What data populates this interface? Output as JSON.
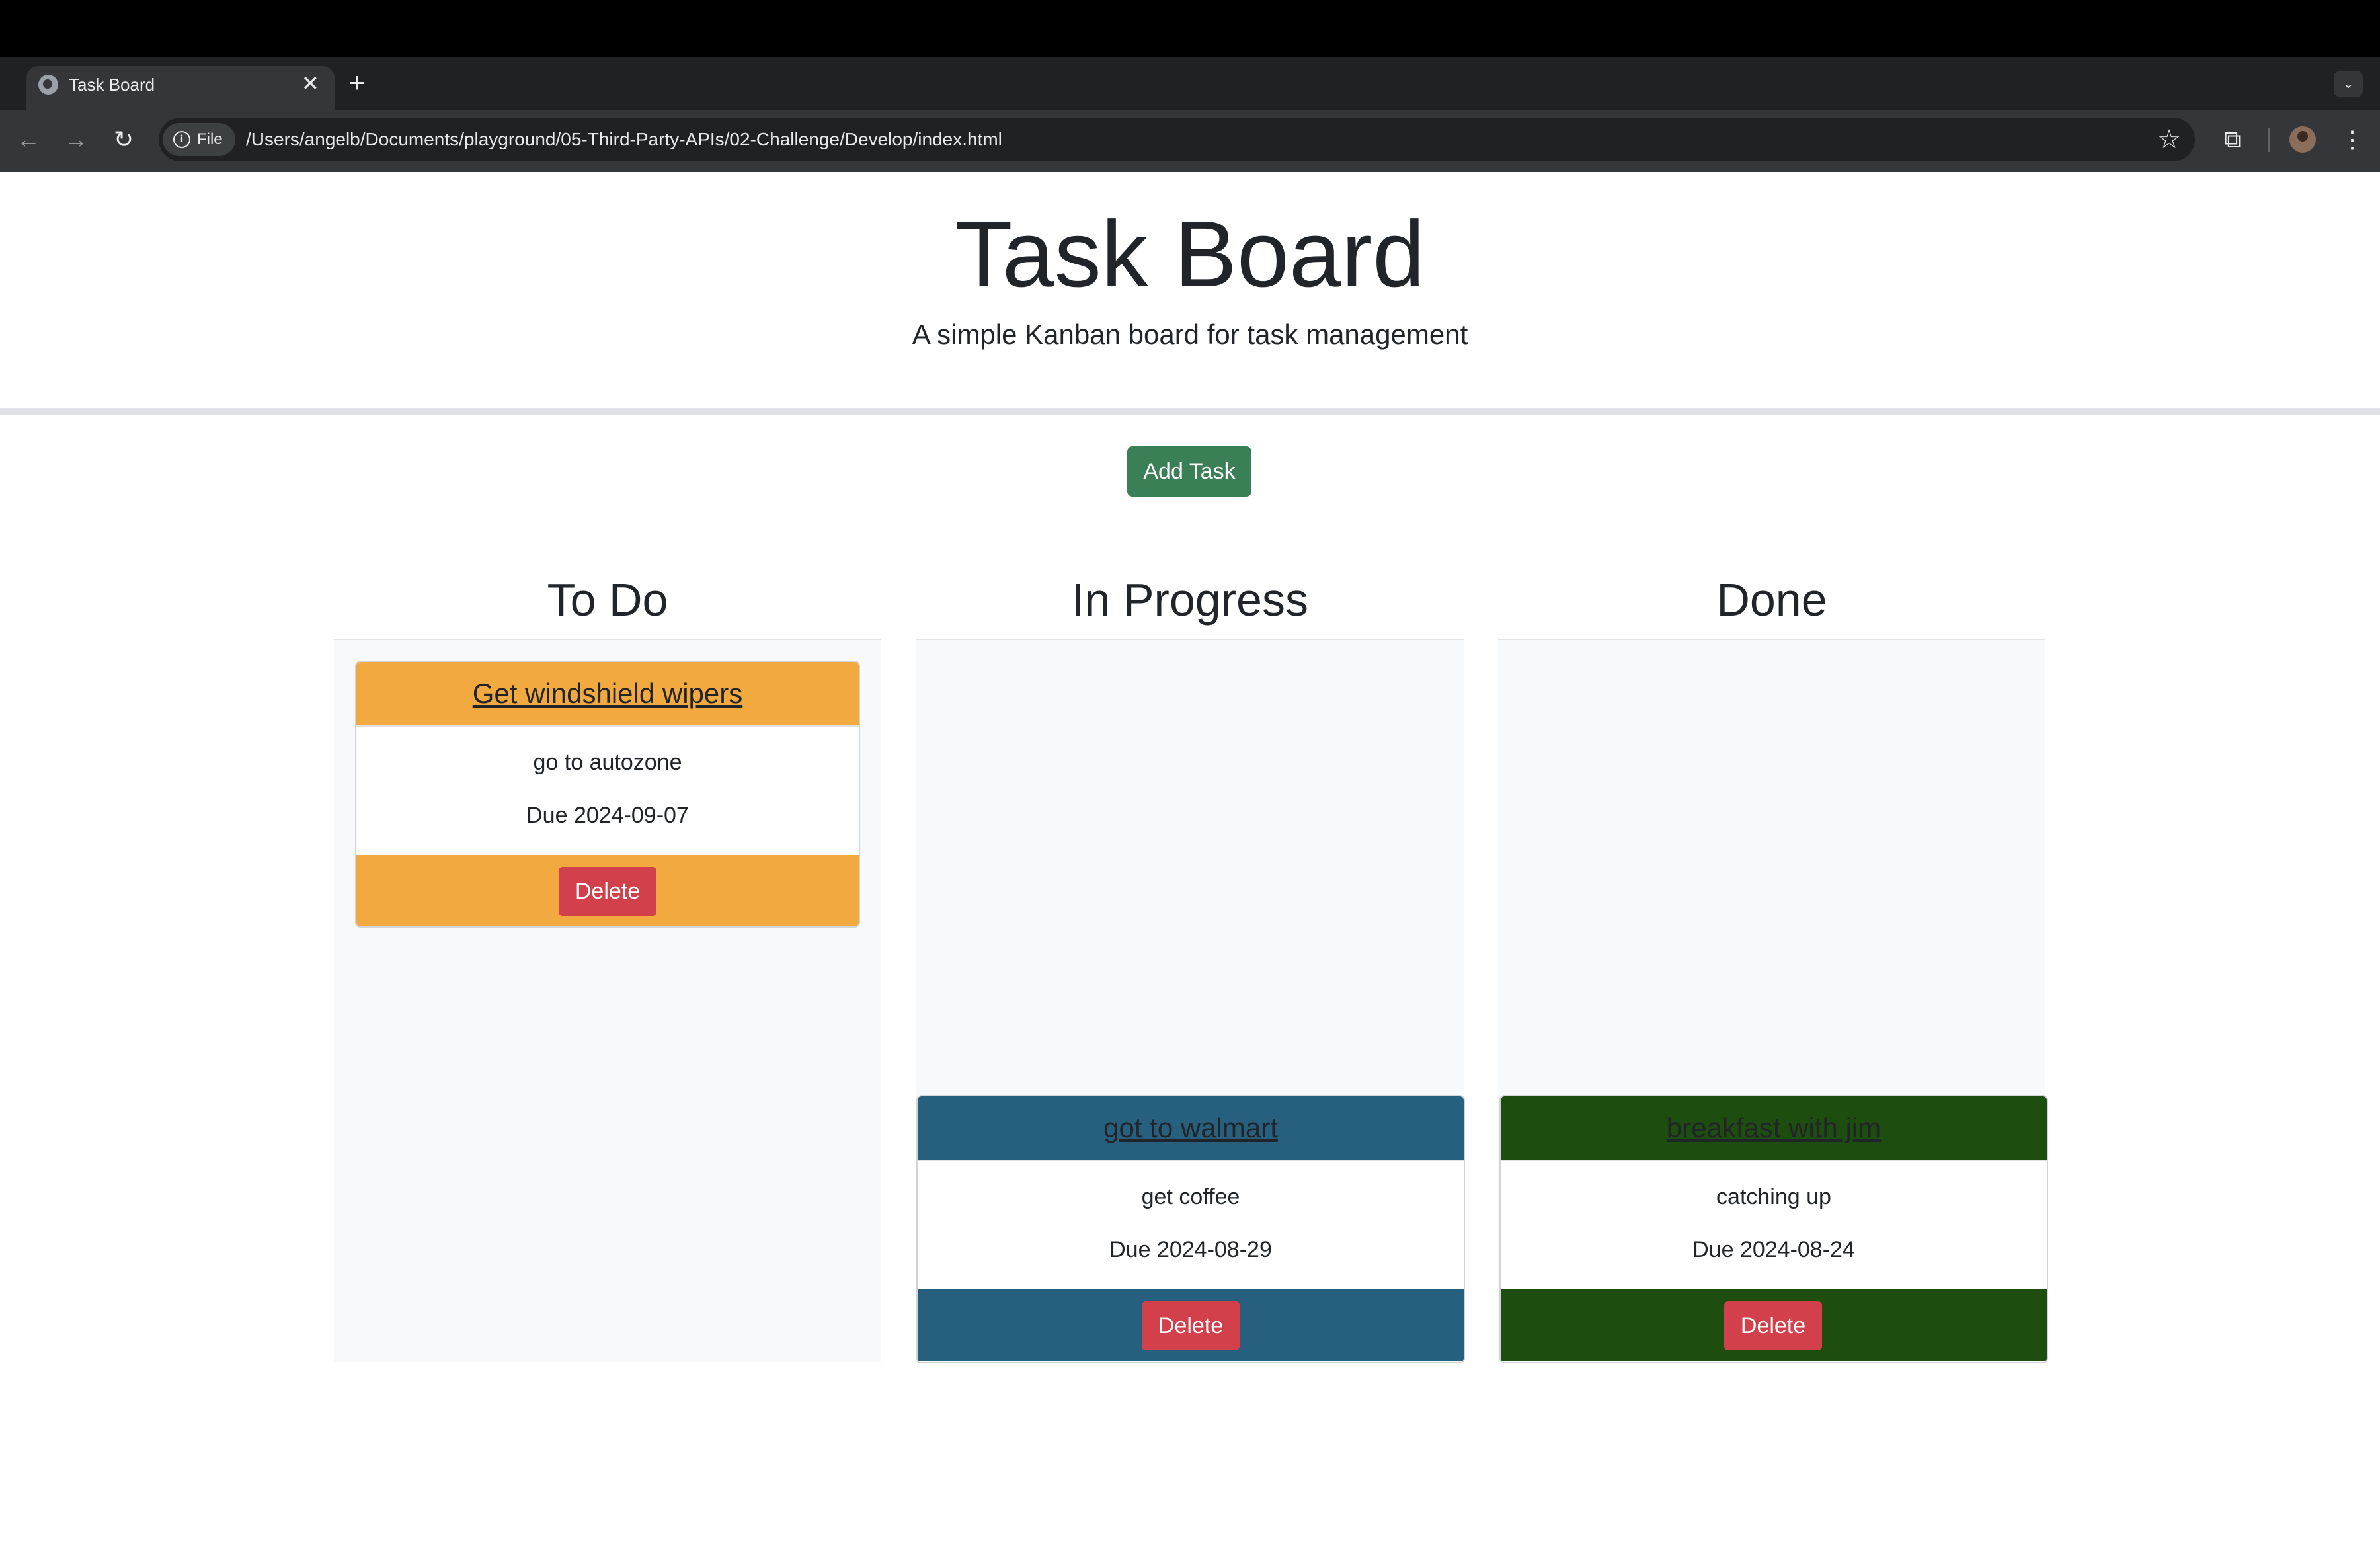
{
  "browser": {
    "tab_title": "Task Board",
    "tab_close": "✕",
    "new_tab": "+",
    "tab_search": "⌄",
    "back": "←",
    "forward": "→",
    "reload": "↻",
    "info": "i",
    "file_label": "File",
    "url": "/Users/angelb/Documents/playground/05-Third-Party-APIs/02-Challenge/Develop/index.html",
    "star": "☆",
    "extensions": "⧉",
    "menu": "⋮"
  },
  "header": {
    "title": "Task Board",
    "subtitle": "A simple Kanban board for task management"
  },
  "add_task_label": "Add Task",
  "lanes": [
    {
      "title": "To Do",
      "cards": [
        {
          "title": "Get windshield wipers",
          "description": "go to autozone",
          "due": "Due 2024-09-07",
          "delete_label": "Delete",
          "color": "#f2a93f"
        }
      ]
    },
    {
      "title": "In Progress",
      "cards": [
        {
          "title": "got to walmart",
          "description": "get coffee",
          "due": "Due 2024-08-29",
          "delete_label": "Delete",
          "color": "#27607e"
        }
      ]
    },
    {
      "title": "Done",
      "cards": [
        {
          "title": "breakfast with jim",
          "description": "catching up",
          "due": "Due 2024-08-24",
          "delete_label": "Delete",
          "color": "#1e4d10"
        }
      ]
    }
  ],
  "colors": {
    "add_button": "#3a7f55",
    "delete_button": "#d1404b",
    "lane_background": "#f8f9fa"
  }
}
